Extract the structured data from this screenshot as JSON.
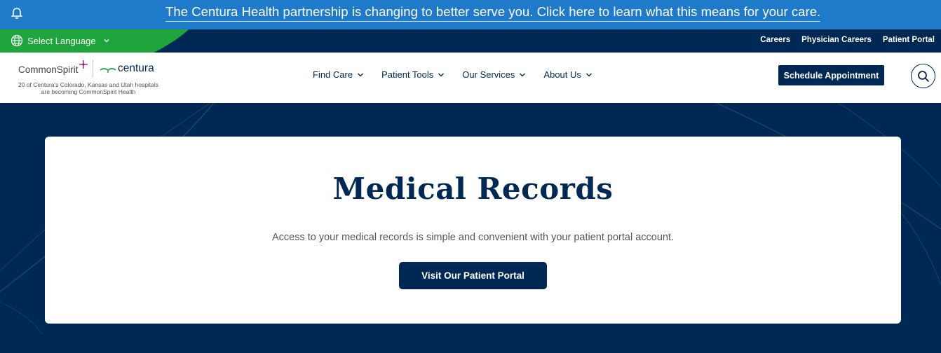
{
  "alert": {
    "message": "The Centura Health partnership is changing to better serve you. Click here to learn what this means for your care.",
    "icon": "bell-icon"
  },
  "utility": {
    "language_label": "Select Language",
    "links": [
      "Careers",
      "Physician Careers",
      "Patient Portal"
    ]
  },
  "logo": {
    "commonspirit": "CommonSpirit",
    "centura": "centura",
    "tagline_line1": "20 of Centura's Colorado, Kansas and Utah hospitals",
    "tagline_line2": "are becoming CommonSpirit Health"
  },
  "nav": {
    "items": [
      "Find Care",
      "Patient Tools",
      "Our Services",
      "About Us"
    ],
    "schedule_label": "Schedule Appointment"
  },
  "hero": {
    "title": "Medical Records",
    "description": "Access to your medical records is simple and convenient with your patient portal account.",
    "button_label": "Visit Our Patient Portal"
  },
  "colors": {
    "navy": "#002855",
    "alert_blue": "#1f7ac9",
    "green": "#1ea53b",
    "white": "#ffffff"
  }
}
